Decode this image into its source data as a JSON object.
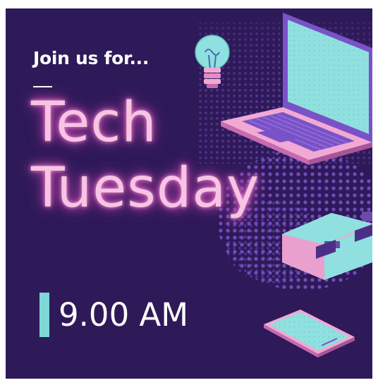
{
  "poster": {
    "intro": "Join us for...",
    "title_line1": "Tech",
    "title_line2": "Tuesday",
    "time": "9.00 AM"
  },
  "colors": {
    "background": "#2e1a58",
    "title_glow": "#f7c4e4",
    "accent_teal": "#7ed8d8",
    "accent_pink": "#f1a9d3",
    "accent_purple": "#7a52c8"
  },
  "icons": [
    "lightbulb-icon",
    "laptop-icon",
    "briefcase-icon",
    "smartphone-icon"
  ]
}
